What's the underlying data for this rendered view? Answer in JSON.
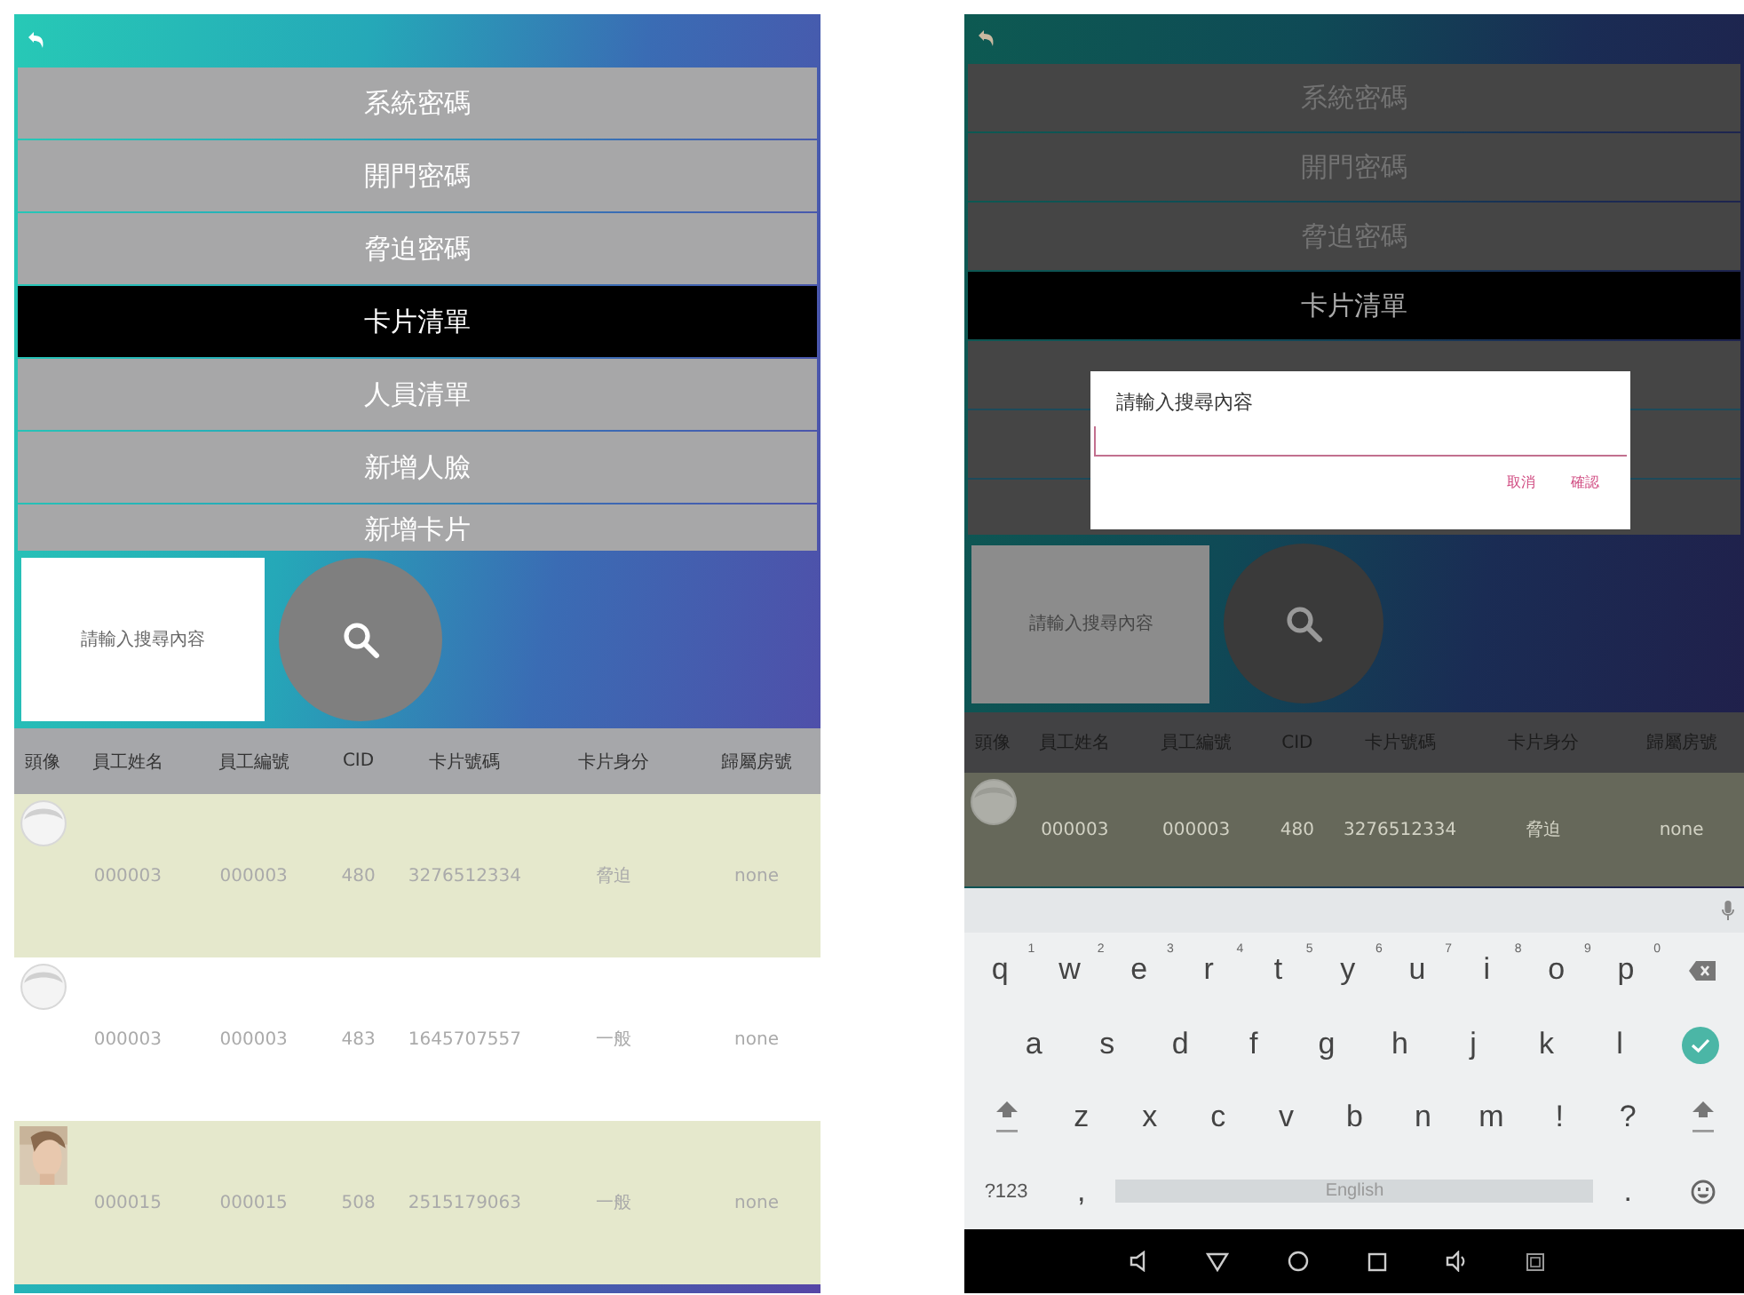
{
  "screens": [
    {
      "kind": "list",
      "menu": [
        {
          "label": "系統密碼",
          "selected": false
        },
        {
          "label": "開門密碼",
          "selected": false
        },
        {
          "label": "脅迫密碼",
          "selected": false
        },
        {
          "label": "卡片清單",
          "selected": true
        },
        {
          "label": "人員清單",
          "selected": false
        },
        {
          "label": "新增人臉",
          "selected": false
        },
        {
          "label": "新增卡片",
          "selected": false
        }
      ],
      "search": {
        "placeholder": "請輸入搜尋內容"
      },
      "table": {
        "columns": [
          "頭像",
          "員工姓名",
          "員工編號",
          "CID",
          "卡片號碼",
          "卡片身分",
          "歸屬房號"
        ],
        "rows": [
          {
            "selected": false,
            "cells": [
              {
                "kind": "icon"
              },
              "000003",
              "000003",
              "480",
              "3276512334",
              "脅迫",
              "none"
            ]
          },
          {
            "selected": true,
            "cells": [
              {
                "kind": "icon"
              },
              "000003",
              "000003",
              "483",
              "1645707557",
              "一般",
              "none"
            ]
          },
          {
            "selected": false,
            "cells": [
              {
                "kind": "picture"
              },
              "000015",
              "000015",
              "508",
              "2515179063",
              "一般",
              "none"
            ]
          }
        ]
      }
    },
    {
      "kind": "dialog",
      "menu": [
        {
          "label": "系統密碼",
          "selected": false
        },
        {
          "label": "開門密碼",
          "selected": false
        },
        {
          "label": "脅迫密碼",
          "selected": false
        },
        {
          "label": "卡片清單",
          "selected": true
        }
      ],
      "dialog": {
        "title": "請輸入搜尋內容",
        "buttons": [
          "取消",
          "確認"
        ]
      },
      "search": {
        "placeholder": "請輸入搜尋內容"
      },
      "table": {
        "columns": [
          "頭像",
          "員工姓名",
          "員工編號",
          "CID",
          "卡片號碼",
          "卡片身分",
          "歸屬房號"
        ],
        "rows": [
          {
            "selected": false,
            "cells": [
              {
                "kind": "icon"
              },
              "000003",
              "000003",
              "480",
              "3276512334",
              "脅迫",
              "none"
            ]
          }
        ]
      },
      "keyboard": {
        "rows": [
          {
            "keys": [
              {
                "kind": "char",
                "label": "q",
                "hint": "1"
              },
              {
                "kind": "char",
                "label": "w",
                "hint": "2"
              },
              {
                "kind": "char",
                "label": "e",
                "hint": "3"
              },
              {
                "kind": "char",
                "label": "r",
                "hint": "4"
              },
              {
                "kind": "char",
                "label": "t",
                "hint": "5"
              },
              {
                "kind": "char",
                "label": "y",
                "hint": "6"
              },
              {
                "kind": "char",
                "label": "u",
                "hint": "7"
              },
              {
                "kind": "char",
                "label": "i",
                "hint": "8"
              },
              {
                "kind": "char",
                "label": "o",
                "hint": "9"
              },
              {
                "kind": "char",
                "label": "p",
                "hint": "0"
              },
              {
                "kind": "backspace"
              }
            ]
          },
          {
            "keys": [
              {
                "kind": "char",
                "label": "a"
              },
              {
                "kind": "char",
                "label": "s"
              },
              {
                "kind": "char",
                "label": "d"
              },
              {
                "kind": "char",
                "label": "f"
              },
              {
                "kind": "char",
                "label": "g"
              },
              {
                "kind": "char",
                "label": "h"
              },
              {
                "kind": "char",
                "label": "j"
              },
              {
                "kind": "char",
                "label": "k"
              },
              {
                "kind": "char",
                "label": "l"
              },
              {
                "kind": "enter"
              }
            ]
          },
          {
            "keys": [
              {
                "kind": "shift"
              },
              {
                "kind": "char",
                "label": "z"
              },
              {
                "kind": "char",
                "label": "x"
              },
              {
                "kind": "char",
                "label": "c"
              },
              {
                "kind": "char",
                "label": "v"
              },
              {
                "kind": "char",
                "label": "b"
              },
              {
                "kind": "char",
                "label": "n"
              },
              {
                "kind": "char",
                "label": "m"
              },
              {
                "kind": "char",
                "label": "!"
              },
              {
                "kind": "char",
                "label": "?"
              },
              {
                "kind": "shift"
              }
            ]
          },
          {
            "keys": [
              {
                "kind": "char",
                "label": "?123"
              },
              {
                "kind": "char",
                "label": ","
              },
              {
                "kind": "space",
                "label": "English"
              },
              {
                "kind": "char",
                "label": "."
              },
              {
                "kind": "emoji"
              }
            ]
          }
        ]
      }
    }
  ]
}
